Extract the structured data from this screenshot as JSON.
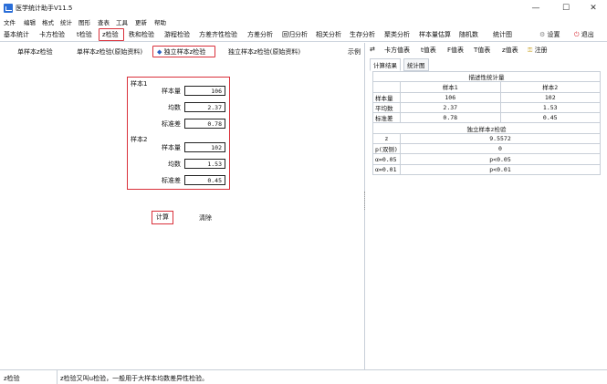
{
  "window": {
    "title": "医学统计助手V11.5",
    "minimize": "—",
    "maximize": "☐",
    "close": "✕"
  },
  "menu": [
    "文件",
    "编辑",
    "格式",
    "统计",
    "图形",
    "查表",
    "工具",
    "更新",
    "帮助"
  ],
  "toolbar": {
    "items": [
      "基本统计",
      "卡方检验",
      "t检验",
      "z检验",
      "秩和检验",
      "游程检验",
      "方差齐性检验",
      "方差分析",
      "回归分析",
      "相关分析",
      "生存分析",
      "聚类分析",
      "样本量估算",
      "随机数",
      "统计图"
    ],
    "settings_label": "设置",
    "exit_label": "退出"
  },
  "subtabs": {
    "items": [
      "单样本z检验",
      "单样本z检验(原始资料)",
      "独立样本z检验",
      "独立样本z检验(原始资料)"
    ],
    "example_label": "示例"
  },
  "form": {
    "sample1_label": "样本1",
    "sample2_label": "样本2",
    "n_label": "样本量",
    "mean_label": "均数",
    "sd_label": "标准差",
    "sample1": {
      "n": "106",
      "mean": "2.37",
      "sd": "0.78"
    },
    "sample2": {
      "n": "102",
      "mean": "1.53",
      "sd": "0.45"
    },
    "calc_button": "计算",
    "clear_button": "清除"
  },
  "right_toolbar": {
    "swap_icon": "⇄",
    "items": [
      "卡方值表",
      "t值表",
      "F值表",
      "T值表",
      "z值表"
    ],
    "register_label": "注册"
  },
  "result_tabs": [
    "计算结果",
    "统计图"
  ],
  "results": {
    "desc_title": "描述性统计量",
    "col_headers": [
      "样本1",
      "样本2"
    ],
    "rows": [
      {
        "label": "样本量",
        "v1": "106",
        "v2": "102"
      },
      {
        "label": "平均数",
        "v1": "2.37",
        "v2": "1.53"
      },
      {
        "label": "标准差",
        "v1": "0.78",
        "v2": "0.45"
      }
    ],
    "test_title": "独立样本z检验",
    "z_label": "z",
    "z_value": "9.5572",
    "p_label": "p(双侧)",
    "p_value": "0",
    "alpha05_label": "α=0.05",
    "alpha05_result": "p<0.05",
    "alpha01_label": "α=0.01",
    "alpha01_result": "p<0.01"
  },
  "status": {
    "left": "z检验",
    "message": "z检验又叫u检验，一般用于大样本均数差异性检验。"
  }
}
